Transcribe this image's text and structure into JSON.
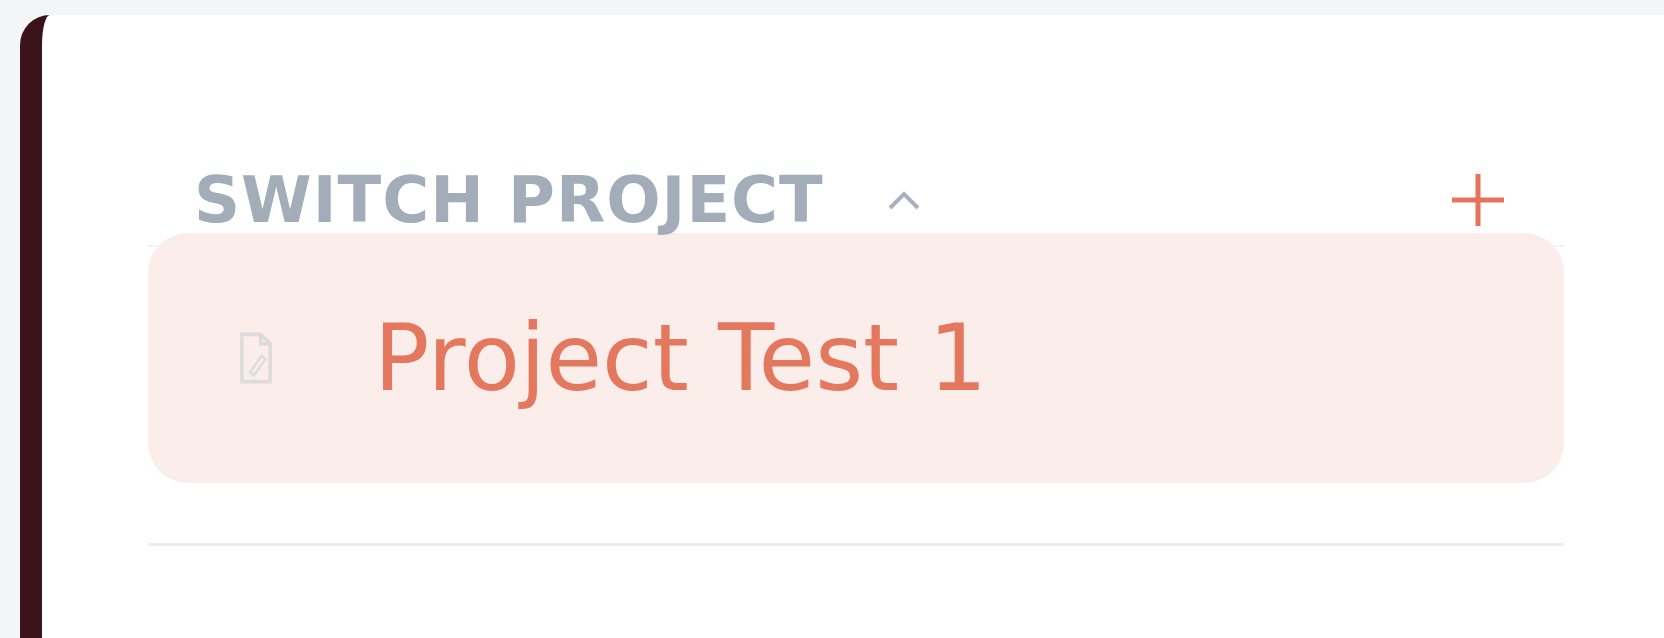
{
  "section": {
    "title": "SWITCH PROJECT",
    "expanded": true
  },
  "projects": [
    {
      "name": "Project Test 1",
      "selected": true
    }
  ]
}
